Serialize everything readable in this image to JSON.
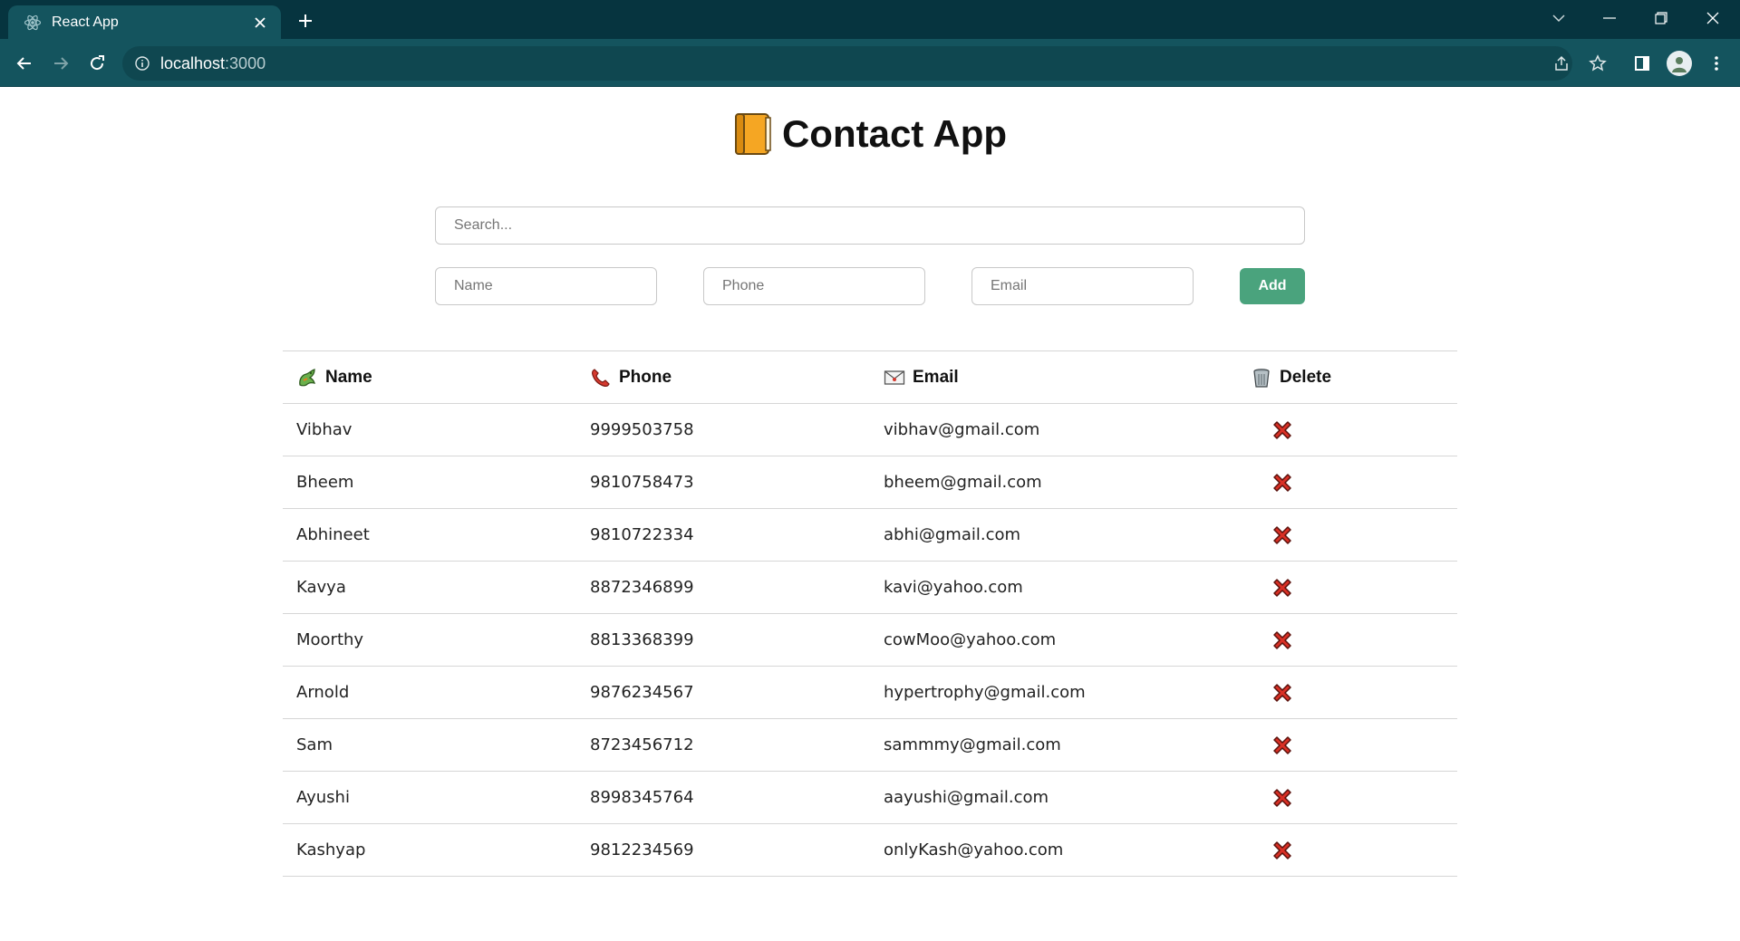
{
  "browser": {
    "tab_title": "React App",
    "url_host": "localhost",
    "url_port": ":3000",
    "accent_color": "#14545e",
    "titlebar_color": "#06343f"
  },
  "app": {
    "title": "Contact App",
    "title_icon": "ledger-book-icon",
    "search_placeholder": "Search...",
    "name_placeholder": "Name",
    "phone_placeholder": "Phone",
    "email_placeholder": "Email",
    "add_label": "Add",
    "add_color": "#4aa37d"
  },
  "table": {
    "headers": {
      "name": "Name",
      "phone": "Phone",
      "email": "Email",
      "delete": "Delete"
    },
    "header_icons": [
      "dragon-icon",
      "phone-receiver-icon",
      "envelope-icon",
      "wastebasket-icon"
    ],
    "rows": [
      {
        "name": "Vibhav",
        "phone": "9999503758",
        "email": "vibhav@gmail.com"
      },
      {
        "name": "Bheem",
        "phone": "9810758473",
        "email": "bheem@gmail.com"
      },
      {
        "name": "Abhineet",
        "phone": "9810722334",
        "email": "abhi@gmail.com"
      },
      {
        "name": "Kavya",
        "phone": "8872346899",
        "email": "kavi@yahoo.com"
      },
      {
        "name": "Moorthy",
        "phone": "8813368399",
        "email": "cowMoo@yahoo.com"
      },
      {
        "name": "Arnold",
        "phone": "9876234567",
        "email": "hypertrophy@gmail.com"
      },
      {
        "name": "Sam",
        "phone": "8723456712",
        "email": "sammmy@gmail.com"
      },
      {
        "name": "Ayushi",
        "phone": "8998345764",
        "email": "aayushi@gmail.com"
      },
      {
        "name": "Kashyap",
        "phone": "9812234569",
        "email": "onlyKash@yahoo.com"
      }
    ],
    "delete_icon": "cross-mark-icon",
    "delete_color": "#d93025"
  }
}
